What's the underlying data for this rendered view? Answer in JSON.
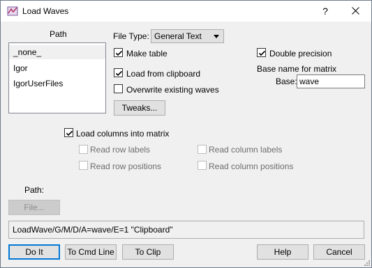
{
  "window": {
    "title": "Load Waves",
    "help_glyph": "?"
  },
  "path_list": {
    "header": "Path",
    "items": [
      "_none_",
      "Igor",
      "IgorUserFiles"
    ]
  },
  "file_type": {
    "label": "File Type:",
    "value": "General Text"
  },
  "options": {
    "make_table": {
      "label": "Make table",
      "checked": true
    },
    "load_from_clipboard": {
      "label": "Load from clipboard",
      "checked": true
    },
    "overwrite": {
      "label": "Overwrite existing waves",
      "checked": false
    },
    "double_precision": {
      "label": "Double precision",
      "checked": true
    },
    "tweaks_label": "Tweaks..."
  },
  "matrix": {
    "base_name_header": "Base name for matrix",
    "base_label": "Base:",
    "base_value": "wave",
    "load_columns": {
      "label": "Load columns into matrix",
      "checked": true
    },
    "read_row_labels": {
      "label": "Read row labels",
      "checked": false,
      "enabled": false
    },
    "read_row_positions": {
      "label": "Read row positions",
      "checked": false,
      "enabled": false
    },
    "read_column_labels": {
      "label": "Read column labels",
      "checked": false,
      "enabled": false
    },
    "read_column_positions": {
      "label": "Read column positions",
      "checked": false,
      "enabled": false
    }
  },
  "path_section": {
    "label": "Path:",
    "file_button": "File..."
  },
  "command": "LoadWave/G/M/D/A=wave/E=1 \"Clipboard\"",
  "buttons": {
    "do_it": "Do It",
    "to_cmd_line": "To Cmd Line",
    "to_clip": "To Clip",
    "help": "Help",
    "cancel": "Cancel"
  },
  "colors": {
    "accent": "#0078d7",
    "disabled": "#6d6d6d"
  }
}
